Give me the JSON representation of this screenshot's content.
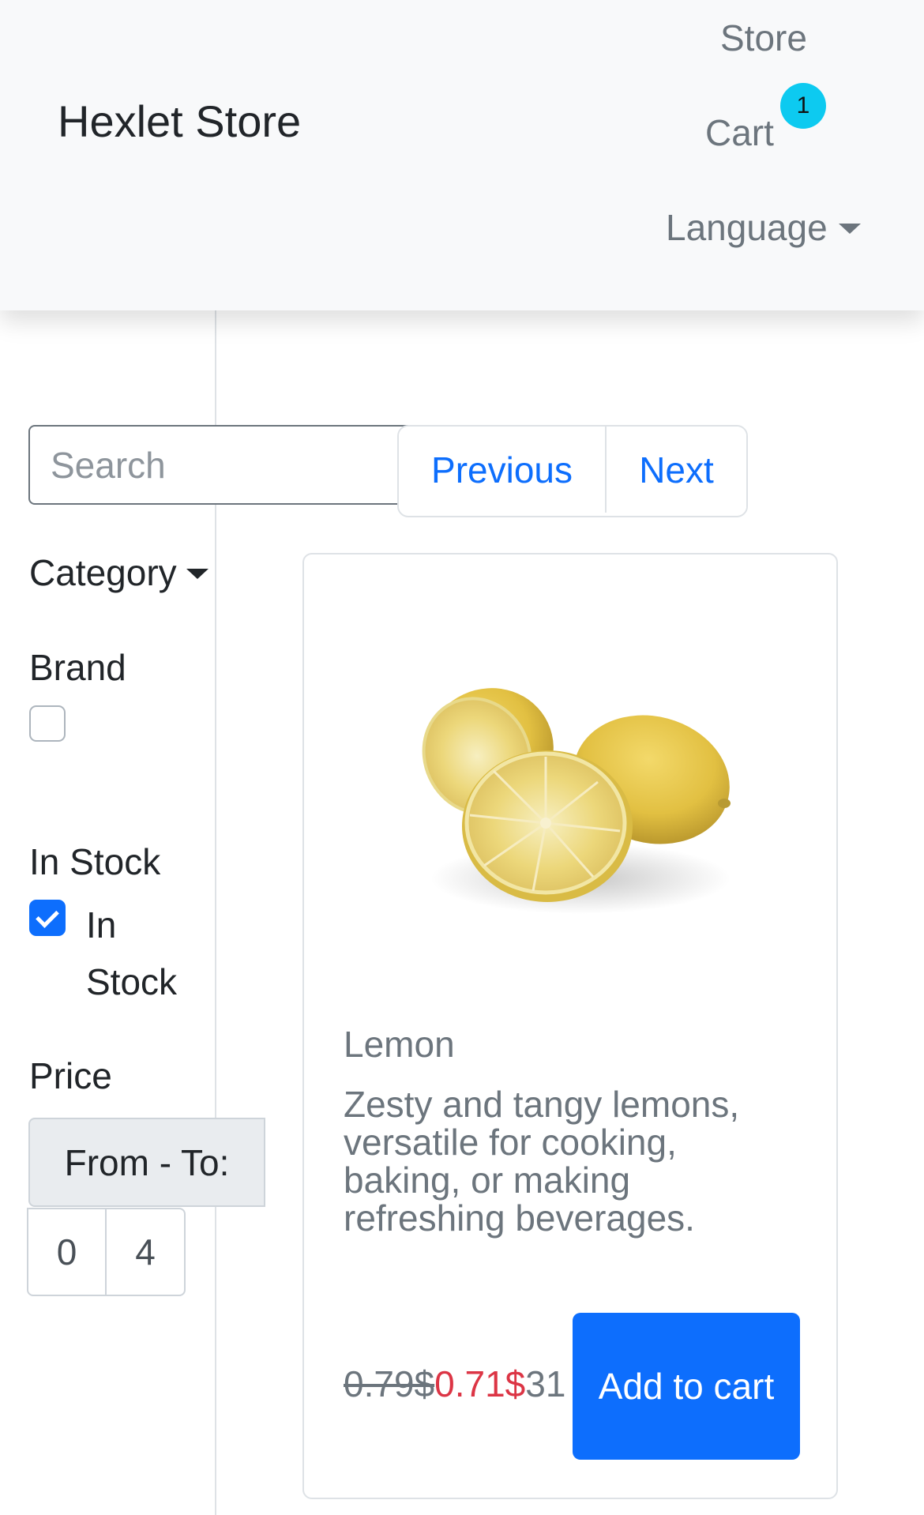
{
  "navbar": {
    "brand": "Hexlet Store",
    "store_link": "Store",
    "cart_link": "Cart",
    "cart_count": "1",
    "language_toggle": "Language"
  },
  "search": {
    "placeholder": "Search",
    "value": ""
  },
  "pagination": {
    "previous_label": "Previous",
    "next_label": "Next"
  },
  "filters": {
    "category_label": "Category",
    "brand_heading": "Brand",
    "brand_checked": false,
    "instock_heading": "In Stock",
    "instock_option_label": "In Stock",
    "instock_checked": true,
    "price_heading": "Price",
    "price_range_label": "From - To:",
    "price_from": "0",
    "price_to": "4"
  },
  "product": {
    "title": "Lemon",
    "description": "Zesty and tangy lemons, versatile for cooking, baking, or making refreshing beverages.",
    "old_price": "0.79$",
    "new_price": "0.71$",
    "stock_count": "31",
    "add_to_cart_label": "Add to cart",
    "image_alt": "lemon-photo"
  },
  "colors": {
    "primary": "#0d6efd",
    "badge": "#0dcaf0",
    "sale_price": "#dc3545",
    "muted": "#6c757d"
  }
}
